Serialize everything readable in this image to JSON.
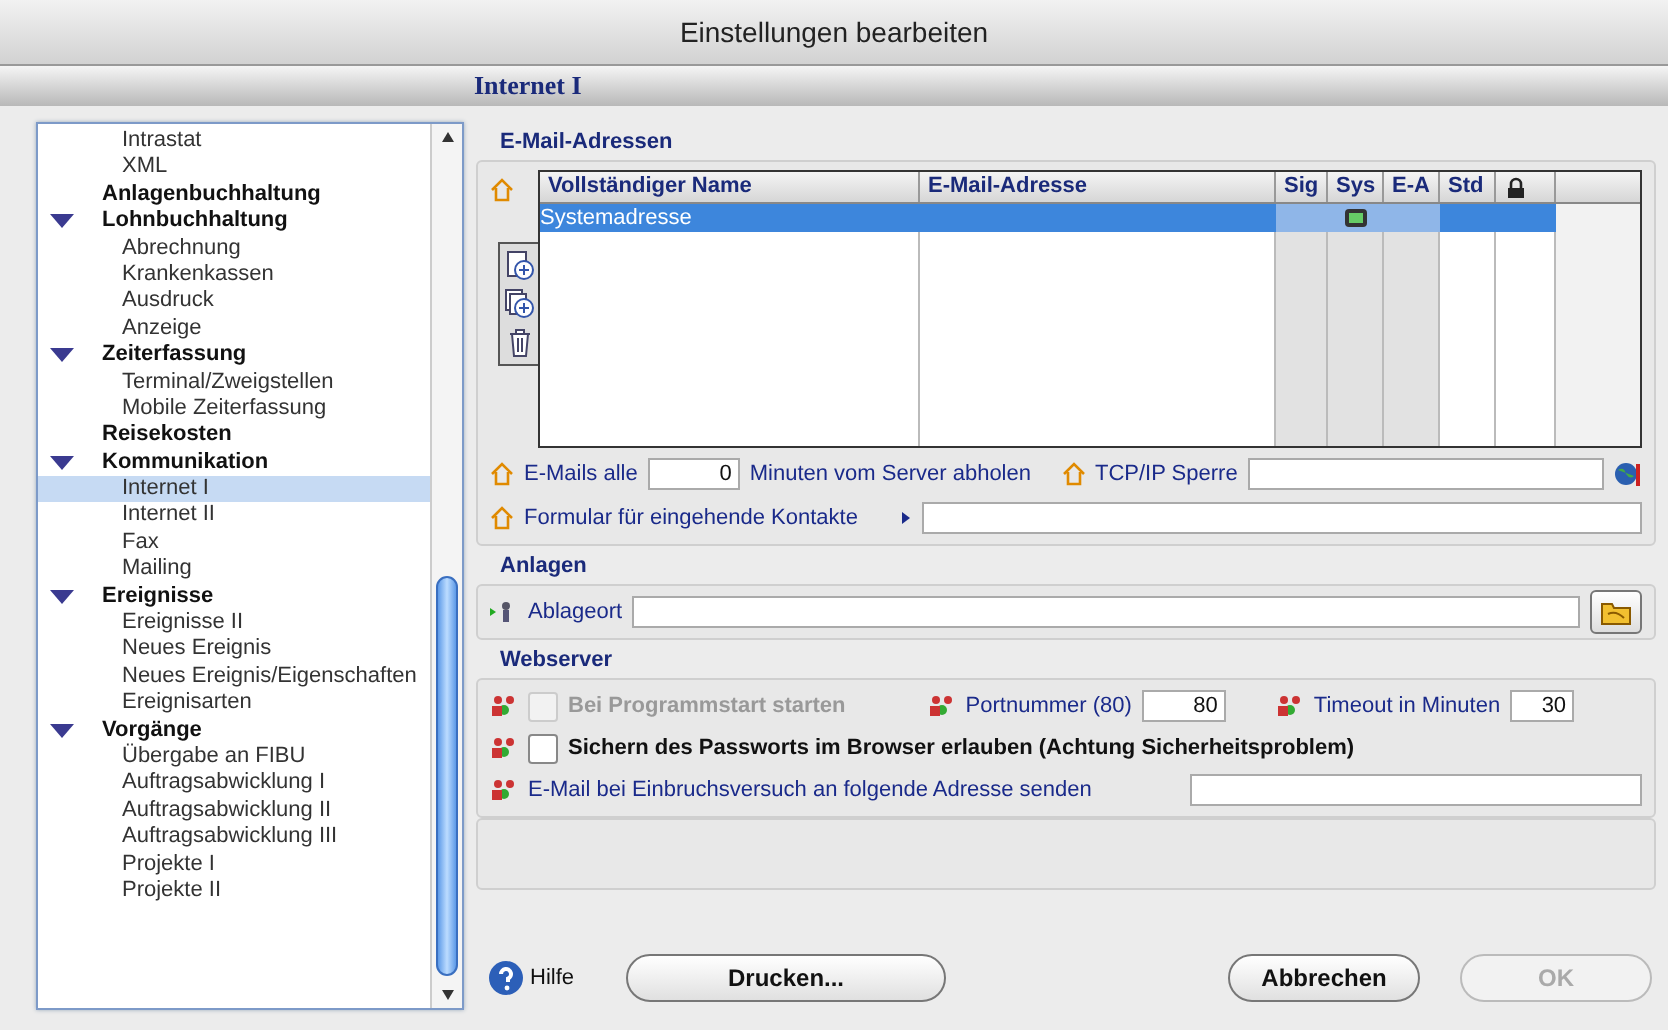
{
  "window": {
    "title": "Einstellungen bearbeiten"
  },
  "page_title": "Internet I",
  "tree": {
    "continued_children": [
      {
        "label": "Intrastat",
        "selected": false
      },
      {
        "label": "XML",
        "selected": false
      }
    ],
    "nodes": [
      {
        "label": "Anlagenbuchhaltung",
        "selected": false
      },
      {
        "label": "Lohnbuchhaltung",
        "selected": false,
        "expanded": true,
        "children": [
          {
            "label": "Abrechnung",
            "selected": false
          },
          {
            "label": "Krankenkassen",
            "selected": false
          },
          {
            "label": "Ausdruck",
            "selected": false
          },
          {
            "label": "Anzeige",
            "selected": false
          }
        ]
      },
      {
        "label": "Zeiterfassung",
        "selected": false,
        "expanded": true,
        "children": [
          {
            "label": "Terminal/Zweigstellen",
            "selected": false
          },
          {
            "label": "Mobile Zeiterfassung",
            "selected": false
          }
        ]
      },
      {
        "label": "Reisekosten",
        "selected": false
      },
      {
        "label": "Kommunikation",
        "selected": false,
        "expanded": true,
        "children": [
          {
            "label": "Internet I",
            "selected": true
          },
          {
            "label": "Internet II",
            "selected": false
          },
          {
            "label": "Fax",
            "selected": false
          },
          {
            "label": "Mailing",
            "selected": false
          }
        ]
      },
      {
        "label": "Ereignisse",
        "selected": false,
        "expanded": true,
        "children": [
          {
            "label": "Ereignisse II",
            "selected": false
          },
          {
            "label": "Neues Ereignis",
            "selected": false
          },
          {
            "label": "Neues Ereignis/Eigenschaften",
            "selected": false
          },
          {
            "label": "Ereignisarten",
            "selected": false
          }
        ]
      },
      {
        "label": "Vorgänge",
        "selected": false,
        "expanded": true,
        "children": [
          {
            "label": "Übergabe an FIBU",
            "selected": false
          },
          {
            "label": "Auftragsabwicklung I",
            "selected": false
          },
          {
            "label": "Auftragsabwicklung II",
            "selected": false
          },
          {
            "label": "Auftragsabwicklung III",
            "selected": false
          },
          {
            "label": "Projekte I",
            "selected": false
          },
          {
            "label": "Projekte II",
            "selected": false
          }
        ]
      }
    ]
  },
  "email_section": {
    "heading": "E-Mail-Adressen",
    "table": {
      "columns": [
        {
          "label": "Vollständiger Name",
          "kind": "text",
          "shaded": false
        },
        {
          "label": "E-Mail-Adresse",
          "kind": "text",
          "shaded": false
        },
        {
          "label": "Sig",
          "kind": "text",
          "shaded": true
        },
        {
          "label": "Sys",
          "kind": "text",
          "shaded": true
        },
        {
          "label": "E-A",
          "kind": "text",
          "shaded": true
        },
        {
          "label": "Std",
          "kind": "text",
          "shaded": false
        },
        {
          "kind": "lock",
          "shaded": false
        }
      ],
      "rows": [
        {
          "name": "Systemadresse",
          "sys": true,
          "selected": true
        }
      ]
    },
    "interval_label": "E-Mails alle",
    "interval_value": "0",
    "interval_suffix": "Minuten vom Server abholen",
    "tcp_label": "TCP/IP Sperre",
    "form_label": "Formular für eingehende Kontakte"
  },
  "attachments": {
    "heading": "Anlagen",
    "location_label": "Ablageort"
  },
  "webserver": {
    "heading": "Webserver",
    "start": {
      "label": "Bei Programmstart starten",
      "checked": false,
      "disabled": true
    },
    "port_label": "Portnummer (80)",
    "port_value": "80",
    "timeout_label": "Timeout in Minuten",
    "timeout_value": "30",
    "password": {
      "label": "Sichern des Passworts im Browser erlauben (Achtung Sicherheitsproblem)",
      "checked": false,
      "disabled": false
    },
    "alert_label": "E-Mail bei Einbruchsversuch an folgende Adresse senden"
  },
  "footer": {
    "help": "Hilfe",
    "buttons": [
      {
        "label": "Drucken...",
        "disabled": false
      },
      {
        "label": "Abbrechen",
        "disabled": false
      },
      {
        "label": "OK",
        "disabled": true
      }
    ]
  }
}
